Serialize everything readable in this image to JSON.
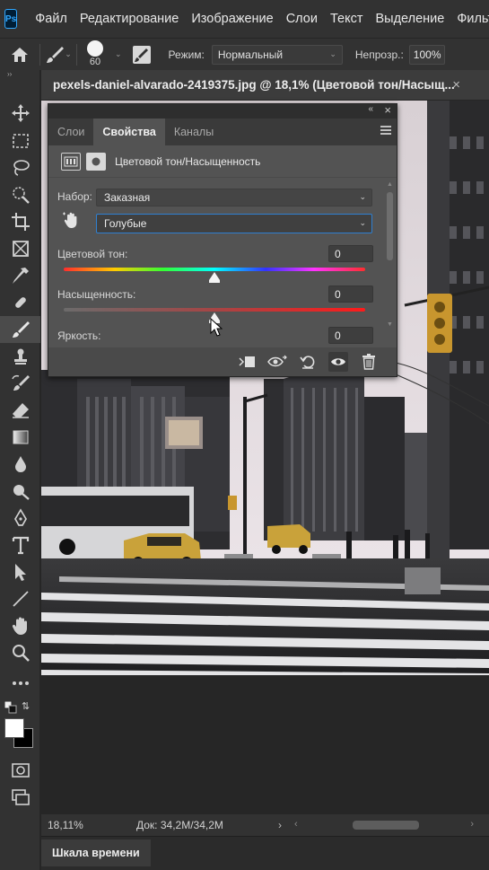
{
  "app": {
    "logo_text": "Ps",
    "menu": [
      "Файл",
      "Редактирование",
      "Изображение",
      "Слои",
      "Текст",
      "Выделение",
      "Фильтр"
    ]
  },
  "options_bar": {
    "brush_size": "60",
    "mode_label": "Режим:",
    "mode_value": "Нормальный",
    "opacity_label": "Непрозр.:",
    "opacity_value": "100%"
  },
  "document": {
    "tab_title": "pexels-daniel-alvarado-2419375.jpg @ 18,1% (Цветовой тон/Насыщ...",
    "close": "×"
  },
  "properties_panel": {
    "tabs": [
      {
        "label": "Слои",
        "active": false
      },
      {
        "label": "Свойства",
        "active": true
      },
      {
        "label": "Каналы",
        "active": false
      }
    ],
    "header_title": "Цветовой тон/Насыщенность",
    "preset_label": "Набор:",
    "preset_value": "Заказная",
    "channel_value": "Голубые",
    "hue_label": "Цветовой тон:",
    "hue_value": "0",
    "hue_position": 0.5,
    "saturation_label": "Насыщенность:",
    "saturation_value": "0",
    "saturation_position": 0.5,
    "lightness_label": "Яркость:",
    "lightness_value": "0"
  },
  "status_bar": {
    "zoom": "18,11%",
    "doc_info": "Док: 34,2M/34,2M",
    "arrow": "›"
  },
  "timeline": {
    "tab_label": "Шкала времени"
  },
  "colors": {
    "foreground": "#ffffff",
    "background": "#000000",
    "accent": "#2f7fd0"
  }
}
